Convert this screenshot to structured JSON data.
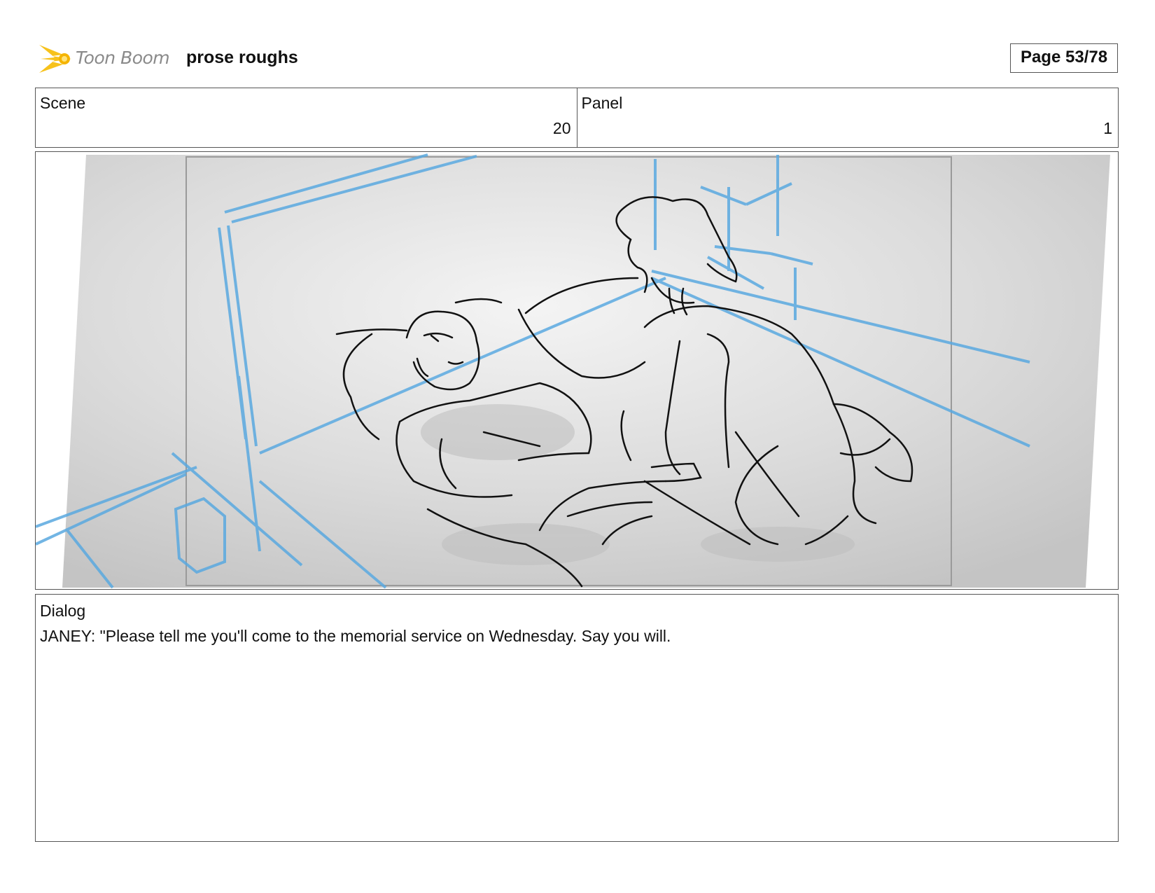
{
  "header": {
    "logo_text": "Toon Boom",
    "logo_icon": "comet-icon",
    "title": "prose roughs",
    "page_label": "Page 53/78"
  },
  "info": {
    "scene_label": "Scene",
    "scene_value": "20",
    "panel_label": "Panel",
    "panel_value": "1"
  },
  "dialog": {
    "label": "Dialog",
    "text": "JANEY: \"Please tell me you'll come to the memorial service on Wednesday. Say you will."
  },
  "colors": {
    "logo_yellow": "#f7c21b",
    "guide_blue": "#5aa9e0",
    "border": "#555555"
  }
}
